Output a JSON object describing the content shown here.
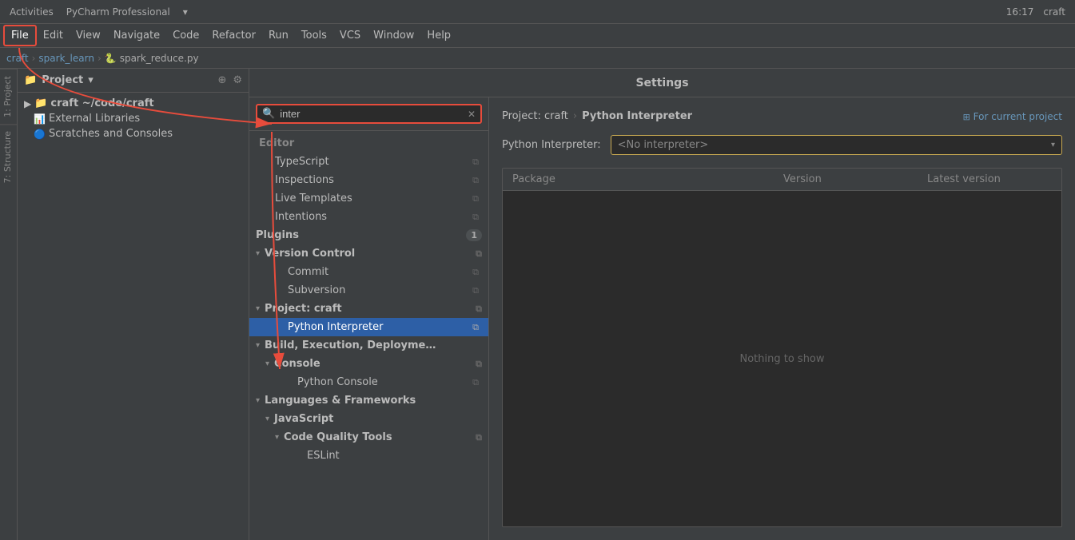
{
  "systemBar": {
    "leftItems": [
      "Activities",
      "PyCharm Professional",
      "▾"
    ],
    "time": "16:17",
    "projectName": "craft"
  },
  "menuBar": {
    "items": [
      "File",
      "Edit",
      "View",
      "Navigate",
      "Code",
      "Refactor",
      "Run",
      "Tools",
      "VCS",
      "Window",
      "Help"
    ],
    "activeItem": "File"
  },
  "breadcrumb": {
    "parts": [
      "craft",
      "spark_learn",
      "spark_reduce.py"
    ]
  },
  "projectPanel": {
    "title": "Project",
    "items": [
      {
        "label": "craft ~/code/craft",
        "indent": 1,
        "bold": true,
        "type": "folder"
      },
      {
        "label": "External Libraries",
        "indent": 2,
        "bold": false,
        "type": "library"
      },
      {
        "label": "Scratches and Consoles",
        "indent": 2,
        "bold": false,
        "type": "scratches"
      }
    ]
  },
  "settingsDialog": {
    "title": "Settings",
    "searchPlaceholder": "inter",
    "searchValue": "inter",
    "navItems": [
      {
        "type": "section",
        "label": "Editor"
      },
      {
        "type": "item",
        "label": "TypeScript",
        "indent": 2,
        "hasCopy": true
      },
      {
        "type": "item",
        "label": "Inspections",
        "indent": 2,
        "hasCopy": true
      },
      {
        "type": "item",
        "label": "Live Templates",
        "indent": 2,
        "hasCopy": true
      },
      {
        "type": "item",
        "label": "Intentions",
        "indent": 2,
        "hasCopy": true
      },
      {
        "type": "group",
        "label": "Plugins",
        "badge": "1",
        "hasCopy": false
      },
      {
        "type": "group",
        "label": "Version Control",
        "indent": 1,
        "chevron": "▾",
        "hasCopy": true
      },
      {
        "type": "item",
        "label": "Commit",
        "indent": 3,
        "hasCopy": true
      },
      {
        "type": "item",
        "label": "Subversion",
        "indent": 3,
        "hasCopy": true
      },
      {
        "type": "group",
        "label": "Project: craft",
        "indent": 1,
        "chevron": "▾",
        "hasCopy": true
      },
      {
        "type": "item",
        "label": "Python Interpreter",
        "indent": 3,
        "hasCopy": true,
        "selected": true
      },
      {
        "type": "group",
        "label": "Build, Execution, Deployme…",
        "indent": 1,
        "chevron": "▾",
        "hasCopy": false
      },
      {
        "type": "group",
        "label": "Console",
        "indent": 2,
        "chevron": "▾",
        "hasCopy": true
      },
      {
        "type": "item",
        "label": "Python Console",
        "indent": 4,
        "hasCopy": true
      },
      {
        "type": "group",
        "label": "Languages & Frameworks",
        "indent": 1,
        "chevron": "▾",
        "hasCopy": false
      },
      {
        "type": "group",
        "label": "JavaScript",
        "indent": 2,
        "chevron": "▾",
        "hasCopy": false
      },
      {
        "type": "group",
        "label": "Code Quality Tools",
        "indent": 3,
        "chevron": "▾",
        "hasCopy": true
      },
      {
        "type": "item",
        "label": "ESLint",
        "indent": 4,
        "hasCopy": false
      }
    ],
    "contentBreadcrumb": {
      "project": "Project: craft",
      "page": "Python Interpreter",
      "forCurrentProject": "For current project"
    },
    "interpreterLabel": "Python Interpreter:",
    "interpreterValue": "<No interpreter>",
    "tableHeaders": [
      "Package",
      "Version",
      "Latest version"
    ],
    "nothingToShow": "Nothing to show"
  }
}
